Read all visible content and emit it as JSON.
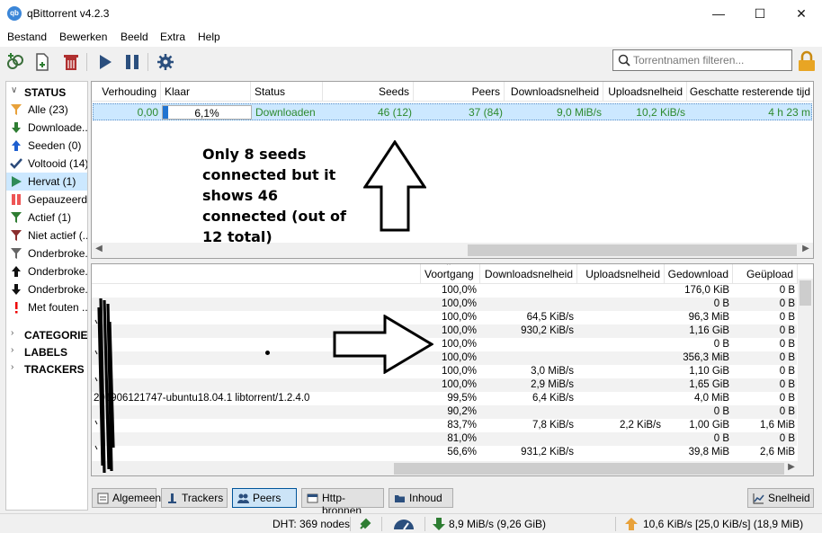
{
  "window": {
    "title": "qBittorrent v4.2.3",
    "icon_text": "qb"
  },
  "menu": [
    "Bestand",
    "Bewerken",
    "Beeld",
    "Extra",
    "Help"
  ],
  "search": {
    "placeholder": "Torrentnamen filteren..."
  },
  "sidebar": {
    "status_header": "STATUS",
    "items": [
      {
        "label": "Alle (23)",
        "icon": "filter-icon",
        "color": "#e8a13a"
      },
      {
        "label": "Downloade...",
        "icon": "download-arrow-icon",
        "color": "#2e7d32"
      },
      {
        "label": "Seeden (0)",
        "icon": "upload-arrow-icon",
        "color": "#1e5fd0"
      },
      {
        "label": "Voltooid (14)",
        "icon": "checkmark-icon",
        "color": "#2a4a7a"
      },
      {
        "label": "Hervat (1)",
        "icon": "play-icon",
        "color": "#2e8b57"
      },
      {
        "label": "Gepauzeerd...",
        "icon": "pause-icon",
        "color": "#e55"
      },
      {
        "label": "Actief (1)",
        "icon": "filter-icon",
        "color": "#2e7d32"
      },
      {
        "label": "Niet actief (...",
        "icon": "filter-icon",
        "color": "#8b2e2e"
      },
      {
        "label": "Onderbroke...",
        "icon": "filter-icon",
        "color": "#666"
      },
      {
        "label": "Onderbroke...",
        "icon": "upload-arrow-icon",
        "color": "#111"
      },
      {
        "label": "Onderbroke...",
        "icon": "download-arrow-icon",
        "color": "#111"
      },
      {
        "label": "Met fouten ...",
        "icon": "exclamation-icon",
        "color": "#e00"
      }
    ],
    "categories_header": "CATEGORIEËN",
    "labels_header": "LABELS",
    "trackers_header": "TRACKERS"
  },
  "torrent_table": {
    "headers": [
      "Verhouding",
      "Klaar",
      "Status",
      "Seeds",
      "Peers",
      "Downloadsnelheid",
      "Uploadsnelheid",
      "Geschatte resterende tijd"
    ],
    "row": {
      "ratio": "0,00",
      "progress_text": "6,1%",
      "progress_fraction": 0.061,
      "status": "Downloaden",
      "seeds": "46 (12)",
      "peers": "37 (84)",
      "down_speed": "9,0 MiB/s",
      "up_speed": "10,2 KiB/s",
      "eta": "4 h 23 m"
    }
  },
  "annotation_top": "Only 8 seeds connected but it shows 46 connected (out of 12 total)",
  "peers_table": {
    "headers": [
      "Voortgang",
      "Downloadsnelheid",
      "Uploadsnelheid",
      "Gedownload",
      "Geüpload"
    ],
    "rows": [
      {
        "client": "",
        "progress": "100,0%",
        "down": "",
        "up": "",
        "downloaded": "176,0 KiB",
        "uploaded": "0 B"
      },
      {
        "client": "",
        "progress": "100,0%",
        "down": "",
        "up": "",
        "downloaded": "0 B",
        "uploaded": "0 B"
      },
      {
        "client": "",
        "progress": "100,0%",
        "down": "64,5 KiB/s",
        "up": "",
        "downloaded": "96,3 MiB",
        "uploaded": "0 B"
      },
      {
        "client": "",
        "progress": "100,0%",
        "down": "930,2 KiB/s",
        "up": "",
        "downloaded": "1,16 GiB",
        "uploaded": "0 B"
      },
      {
        "client": "",
        "progress": "100,0%",
        "down": "",
        "up": "",
        "downloaded": "0 B",
        "uploaded": "0 B"
      },
      {
        "client": "",
        "progress": "100,0%",
        "down": "",
        "up": "",
        "downloaded": "356,3 MiB",
        "uploaded": "0 B"
      },
      {
        "client": "",
        "progress": "100,0%",
        "down": "3,0 MiB/s",
        "up": "",
        "downloaded": "1,10 GiB",
        "uploaded": "0 B"
      },
      {
        "client": "",
        "progress": "100,0%",
        "down": "2,9 MiB/s",
        "up": "",
        "downloaded": "1,65 GiB",
        "uploaded": "0 B"
      },
      {
        "client": "201906121747-ubuntu18.04.1 libtorrent/1.2.4.0",
        "progress": "99,5%",
        "down": "6,4 KiB/s",
        "up": "",
        "downloaded": "4,0 MiB",
        "uploaded": "0 B"
      },
      {
        "client": "",
        "progress": "90,2%",
        "down": "",
        "up": "",
        "downloaded": "0 B",
        "uploaded": "0 B"
      },
      {
        "client": "",
        "progress": "83,7%",
        "down": "7,8 KiB/s",
        "up": "2,2 KiB/s",
        "downloaded": "1,00 GiB",
        "uploaded": "1,6 MiB"
      },
      {
        "client": "",
        "progress": "81,0%",
        "down": "",
        "up": "",
        "downloaded": "0 B",
        "uploaded": "0 B"
      },
      {
        "client": "",
        "progress": "56,6%",
        "down": "931,2 KiB/s",
        "up": "",
        "downloaded": "39,8 MiB",
        "uploaded": "2,6 MiB"
      }
    ]
  },
  "bottom_tabs": [
    "Algemeen",
    "Trackers",
    "Peers",
    "Http-bronnen",
    "Inhoud"
  ],
  "speed_button": "Snelheid",
  "statusbar": {
    "dht": "DHT: 369 nodes",
    "download": "8,9 MiB/s (9,26 GiB)",
    "upload": "10,6 KiB/s [25,0 KiB/s] (18,9 MiB)"
  }
}
